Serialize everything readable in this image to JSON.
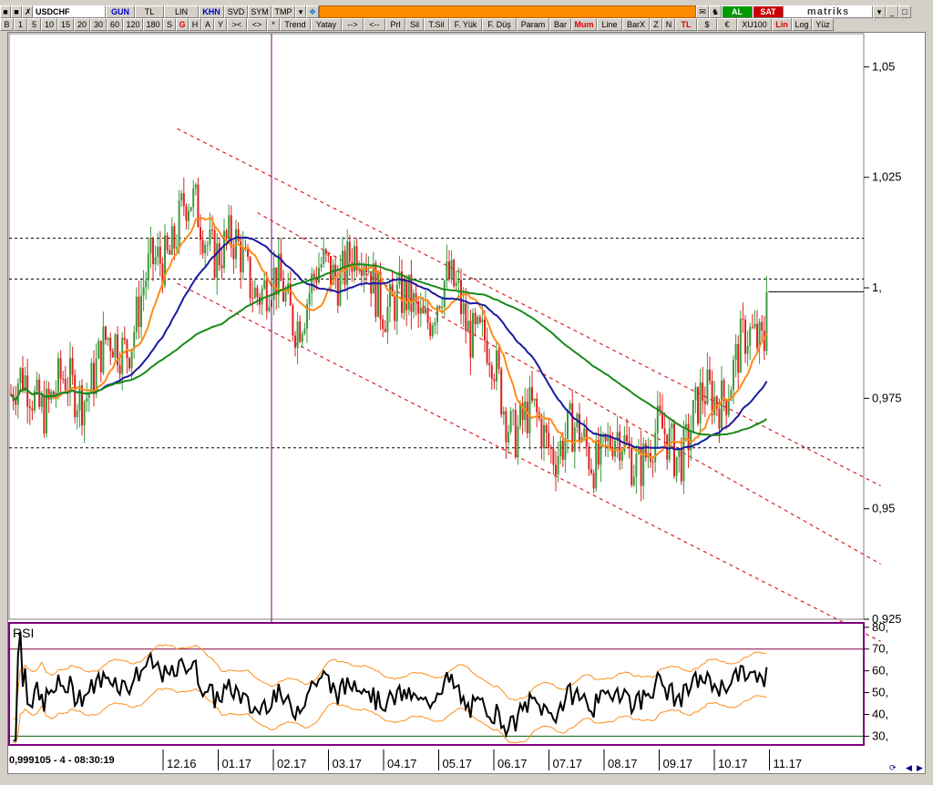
{
  "toolbar_top": {
    "symbol": "USDCHF",
    "period": "GUN",
    "currency": "TL",
    "scale": "LIN",
    "buttons": [
      "KHN",
      "SVD",
      "SYM",
      "TMP"
    ],
    "buy_label": "AL",
    "sell_label": "SAT",
    "brand": "matriks"
  },
  "toolbar_bottom": {
    "periods": [
      "B",
      "1",
      "5",
      "10",
      "15",
      "20",
      "30",
      "60",
      "120",
      "180",
      "S",
      "G",
      "H",
      "A",
      "Y"
    ],
    "nav": [
      ">< ",
      "<>",
      "*"
    ],
    "tools": [
      "Trend",
      "Yatay",
      "-->",
      "<--",
      "Prl",
      "Sil",
      "T.Sil",
      "F. Yük",
      "F. Düş",
      "Param"
    ],
    "types": [
      "Bar",
      "Mum",
      "Line",
      "BarX"
    ],
    "zoom": [
      "Z",
      "N"
    ],
    "ccy": [
      "TL",
      "$",
      "€"
    ],
    "index": "XU100",
    "scales": [
      "Lin",
      "Log",
      "Yüz"
    ]
  },
  "status_text": "0,999105 - 4 - 08:30:19",
  "colors": {
    "up": "#3c9a3c",
    "down": "#e02020",
    "ma_short": "#ff8c1a",
    "ma_mid": "#1a1aa0",
    "ma_long": "#1a8a1a",
    "channel": "#e02020",
    "rsi": "#000000",
    "rsi_band": "#ff8c1a",
    "cursor": "#800080"
  },
  "chart_data": [
    {
      "type": "line",
      "subtype": "candlestick",
      "symbol": "USDCHF",
      "y_ticks": [
        "1,05",
        "1,025",
        "1,",
        "0,975",
        "0,95",
        "0,925"
      ],
      "ylim": [
        0.925,
        1.0575
      ],
      "x_ticks": [
        "12.16",
        "01.17",
        "02.17",
        "03.17",
        "04.17",
        "05.17",
        "06.17",
        "07.17",
        "08.17",
        "09.17",
        "10.17",
        "11.17"
      ],
      "horizontal_levels": [
        1.0112,
        1.002,
        0.9638
      ],
      "last_price": 0.9991,
      "channel_lines": [
        {
          "from": [
            "11.16",
            1.036
          ],
          "to": [
            "11.17",
            0.9552
          ]
        },
        {
          "from": [
            "11.16",
            1.001
          ],
          "to": [
            "11.17",
            0.92
          ]
        },
        {
          "from": [
            "03.17",
            1.017
          ],
          "to": [
            "11.17",
            0.9375
          ]
        }
      ],
      "series": [
        {
          "name": "close",
          "x": [
            "10.16",
            "11.16",
            "12.16",
            "01.17",
            "02.17",
            "03.17",
            "04.17",
            "05.17",
            "06.17",
            "07.17",
            "08.17",
            "09.17",
            "10.17",
            "11.17"
          ],
          "values": [
            0.976,
            0.99,
            1.018,
            1.006,
            0.995,
            1.008,
            0.994,
            0.999,
            0.97,
            0.965,
            0.963,
            0.965,
            0.982,
            0.999
          ]
        }
      ]
    },
    {
      "type": "line",
      "title": "RSI",
      "y_ticks": [
        "80,",
        "70,",
        "60,",
        "50,",
        "40,",
        "30,"
      ],
      "ylim": [
        26,
        82
      ],
      "levels": [
        70,
        30
      ]
    }
  ]
}
